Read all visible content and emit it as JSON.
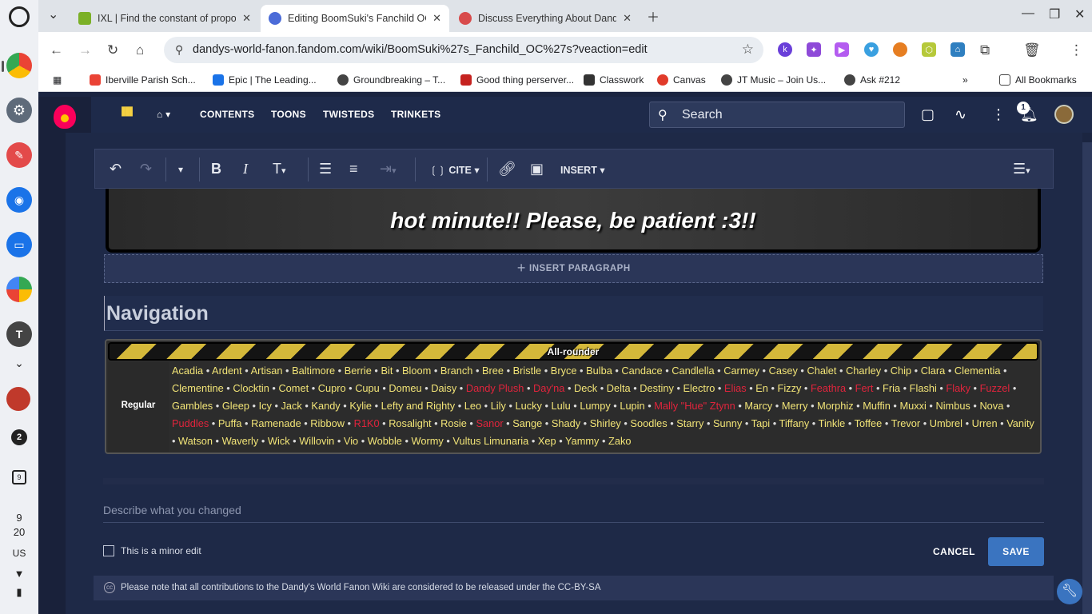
{
  "shelf": {
    "notification_count": "2",
    "calendar_day": "9",
    "clock_hour": "9",
    "clock_minute": "20",
    "locale": "US"
  },
  "browser": {
    "tabs": [
      {
        "title": "IXL | Find the constant of propo",
        "favicon_color": "#7bb027",
        "active": false
      },
      {
        "title": "Editing BoomSuki's Fanchild OC",
        "favicon_color": "#4b6bd8",
        "active": true
      },
      {
        "title": "Discuss Everything About Dand",
        "favicon_color": "#d84b4b",
        "active": false
      }
    ],
    "url": "dandys-world-fanon.fandom.com/wiki/BoomSuki%27s_Fanchild_OC%27s?veaction=edit",
    "bookmarks": [
      {
        "label": "Iberville Parish Sch...",
        "color": "#ea4335"
      },
      {
        "label": "Epic | The Leading...",
        "color": "#1a73e8"
      },
      {
        "label": "Groundbreaking – T...",
        "color": "#444444"
      },
      {
        "label": "Good thing perserver...",
        "color": "#c5221f"
      },
      {
        "label": "Classwork",
        "color": "#333333"
      },
      {
        "label": "Canvas",
        "color": "#e13b2a"
      },
      {
        "label": "JT Music – Join Us...",
        "color": "#444444"
      },
      {
        "label": "Ask #212",
        "color": "#444444"
      }
    ],
    "all_bookmarks": "All Bookmarks"
  },
  "fandom": {
    "nav": [
      "CONTENTS",
      "TOONS",
      "TWISTEDS",
      "TRINKETS"
    ],
    "search_placeholder": "Search",
    "notification_badge": "1"
  },
  "editor": {
    "toolbar": {
      "cite": "CITE",
      "insert": "INSERT"
    },
    "banner_text": "hot minute!! Please, be patient :3!!",
    "insert_paragraph": "INSERT PARAGRAPH",
    "heading": "Navigation",
    "navbox": {
      "header": "All-rounder",
      "group": "Regular",
      "names": [
        {
          "t": "Acadia"
        },
        {
          "t": "Ardent"
        },
        {
          "t": "Artisan"
        },
        {
          "t": "Baltimore"
        },
        {
          "t": "Berrie"
        },
        {
          "t": "Bit"
        },
        {
          "t": "Bloom"
        },
        {
          "t": "Branch"
        },
        {
          "t": "Bree"
        },
        {
          "t": "Bristle"
        },
        {
          "t": "Bryce"
        },
        {
          "t": "Bulba"
        },
        {
          "t": "Candace"
        },
        {
          "t": "Candlella"
        },
        {
          "t": "Carmey"
        },
        {
          "t": "Casey"
        },
        {
          "t": "Chalet"
        },
        {
          "t": "Charley"
        },
        {
          "t": "Chip"
        },
        {
          "t": "Clara"
        },
        {
          "t": "Clementia"
        },
        {
          "t": "Clementine"
        },
        {
          "t": "Clocktin"
        },
        {
          "t": "Comet"
        },
        {
          "t": "Cupro"
        },
        {
          "t": "Cupu"
        },
        {
          "t": "Domeu"
        },
        {
          "t": "Daisy"
        },
        {
          "t": "Dandy Plush",
          "red": true
        },
        {
          "t": "Day'na",
          "red": true
        },
        {
          "t": "Deck"
        },
        {
          "t": "Delta"
        },
        {
          "t": "Destiny"
        },
        {
          "t": "Electro"
        },
        {
          "t": "Elias",
          "red": true
        },
        {
          "t": "En"
        },
        {
          "t": "Fizzy"
        },
        {
          "t": "Feathra",
          "red": true
        },
        {
          "t": "Fert",
          "red": true
        },
        {
          "t": "Fria"
        },
        {
          "t": "Flashi"
        },
        {
          "t": "Flaky",
          "red": true
        },
        {
          "t": "Fuzzel",
          "red": true
        },
        {
          "t": "Gambles"
        },
        {
          "t": "Gleep"
        },
        {
          "t": "Icy"
        },
        {
          "t": "Jack"
        },
        {
          "t": "Kandy"
        },
        {
          "t": "Kylie"
        },
        {
          "t": "Lefty and Righty"
        },
        {
          "t": "Leo"
        },
        {
          "t": "Lily"
        },
        {
          "t": "Lucky"
        },
        {
          "t": "Lulu"
        },
        {
          "t": "Lumpy"
        },
        {
          "t": "Lupin"
        },
        {
          "t": "Mally \"Hue\" Ztynn",
          "red": true
        },
        {
          "t": "Marcy"
        },
        {
          "t": "Merry"
        },
        {
          "t": "Morphiz"
        },
        {
          "t": "Muffin"
        },
        {
          "t": "Muxxi"
        },
        {
          "t": "Nimbus"
        },
        {
          "t": "Nova"
        },
        {
          "t": "Puddles",
          "red": true
        },
        {
          "t": "Puffa"
        },
        {
          "t": "Ramenade"
        },
        {
          "t": "Ribbow"
        },
        {
          "t": "R1K0",
          "red": true
        },
        {
          "t": "Rosalight"
        },
        {
          "t": "Rosie"
        },
        {
          "t": "Sanor",
          "red": true
        },
        {
          "t": "Sange"
        },
        {
          "t": "Shady"
        },
        {
          "t": "Shirley"
        },
        {
          "t": "Soodles"
        },
        {
          "t": "Starry"
        },
        {
          "t": "Sunny"
        },
        {
          "t": "Tapi"
        },
        {
          "t": "Tiffany"
        },
        {
          "t": "Tinkle"
        },
        {
          "t": "Toffee"
        },
        {
          "t": "Trevor"
        },
        {
          "t": "Umbrel"
        },
        {
          "t": "Urren"
        },
        {
          "t": "Vanity"
        },
        {
          "t": "Watson"
        },
        {
          "t": "Waverly"
        },
        {
          "t": "Wick"
        },
        {
          "t": "Willovin"
        },
        {
          "t": "Vio"
        },
        {
          "t": "Wobble"
        },
        {
          "t": "Wormy"
        },
        {
          "t": "Vultus Limunaria"
        },
        {
          "t": "Xep"
        },
        {
          "t": "Yammy"
        },
        {
          "t": "Zako"
        }
      ]
    },
    "summary_placeholder": "Describe what you changed",
    "minor_edit": "This is a minor edit",
    "cancel": "CANCEL",
    "save": "SAVE",
    "license": "Please note that all contributions to the Dandy's World Fanon Wiki are considered to be released under the CC-BY-SA"
  }
}
